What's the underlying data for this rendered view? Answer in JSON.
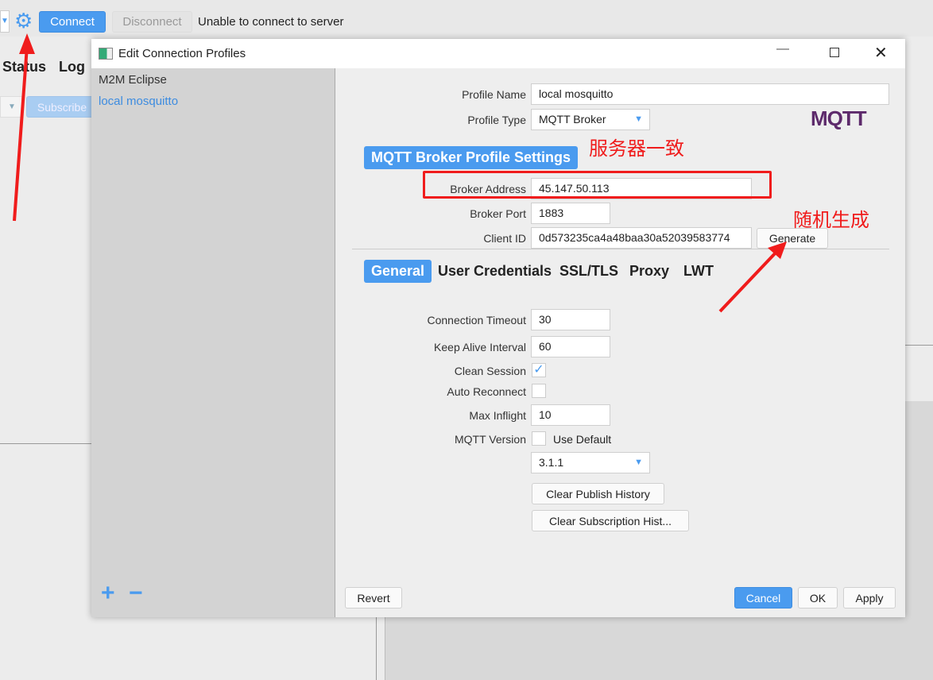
{
  "toolbar": {
    "connect": "Connect",
    "disconnect": "Disconnect",
    "status": "Unable to connect to server"
  },
  "main_tabs": [
    "Status",
    "Log"
  ],
  "subscribe": "Subscribe",
  "dialog": {
    "title": "Edit Connection Profiles",
    "profiles": [
      {
        "label": "M2M Eclipse",
        "selected": false
      },
      {
        "label": "local mosquitto",
        "selected": true
      }
    ],
    "add_label": "+",
    "remove_label": "−",
    "profile_name_label": "Profile Name",
    "profile_name": "local mosquitto",
    "profile_type_label": "Profile Type",
    "profile_type": "MQTT Broker",
    "logo": "MQTT",
    "section_title": "MQTT Broker Profile Settings",
    "broker_address_label": "Broker Address",
    "broker_address": "45.147.50.113",
    "broker_port_label": "Broker Port",
    "broker_port": "1883",
    "client_id_label": "Client ID",
    "client_id": "0d573235ca4a48baa30a52039583774",
    "generate": "Generate",
    "tabs": [
      {
        "label": "General",
        "active": true
      },
      {
        "label": "User Credentials"
      },
      {
        "label": "SSL/TLS"
      },
      {
        "label": "Proxy"
      },
      {
        "label": "LWT"
      }
    ],
    "general": {
      "connection_timeout_label": "Connection Timeout",
      "connection_timeout": "30",
      "keep_alive_label": "Keep Alive Interval",
      "keep_alive": "60",
      "clean_session_label": "Clean Session",
      "clean_session": true,
      "auto_reconnect_label": "Auto Reconnect",
      "auto_reconnect": false,
      "max_inflight_label": "Max Inflight",
      "max_inflight": "10",
      "mqtt_version_label": "MQTT Version",
      "use_default_label": "Use Default",
      "use_default": false,
      "mqtt_version": "3.1.1",
      "clear_publish": "Clear Publish History",
      "clear_subscription": "Clear Subscription Hist..."
    },
    "revert": "Revert",
    "cancel": "Cancel",
    "ok": "OK",
    "apply": "Apply"
  },
  "annotations": {
    "server_match": "服务器一致",
    "random_gen": "随机生成"
  },
  "colors": {
    "accent": "#4a9bef",
    "annotation": "#f01c1c"
  }
}
